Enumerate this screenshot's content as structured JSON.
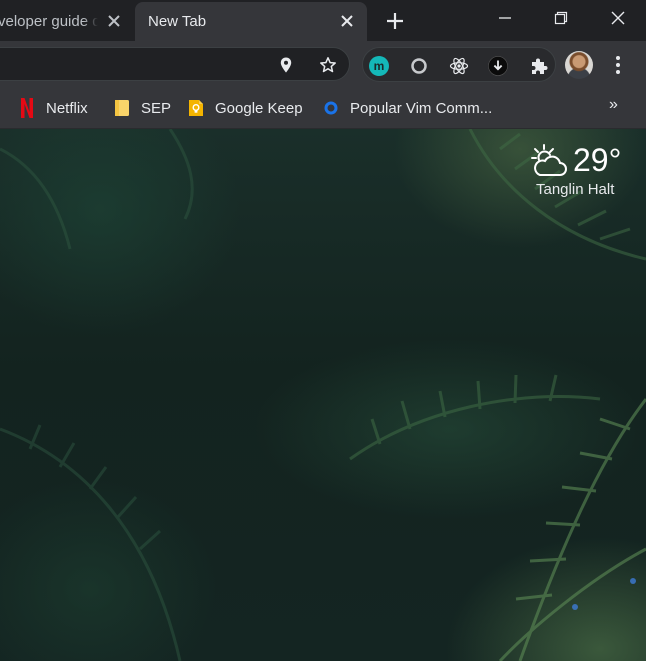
{
  "tabs": [
    {
      "title": "veloper guide d",
      "active": false
    },
    {
      "title": "New Tab",
      "active": true
    }
  ],
  "omnibox": {
    "value": "",
    "placeholder": ""
  },
  "extensions": [
    "m-extension-icon",
    "circle-extension-icon",
    "react-devtools-icon",
    "download-extension-icon",
    "puzzle-extensions-icon"
  ],
  "bookmarks": [
    {
      "label": "Netflix",
      "icon": "netflix-icon"
    },
    {
      "label": "SEP",
      "icon": "folder-icon"
    },
    {
      "label": "Google Keep",
      "icon": "keep-icon"
    },
    {
      "label": "Popular Vim Comm...",
      "icon": "vim-icon"
    }
  ],
  "bookmarks_more": "»",
  "weather": {
    "temp": "29°",
    "location": "Tanglin Halt",
    "icon": "partly-cloudy-icon"
  },
  "colors": {
    "tabstrip": "#202124",
    "toolbar": "#35363a",
    "text": "#e8eaed",
    "netflix": "#e50914",
    "keep": "#f4b400",
    "vim": "#1a73e8"
  }
}
